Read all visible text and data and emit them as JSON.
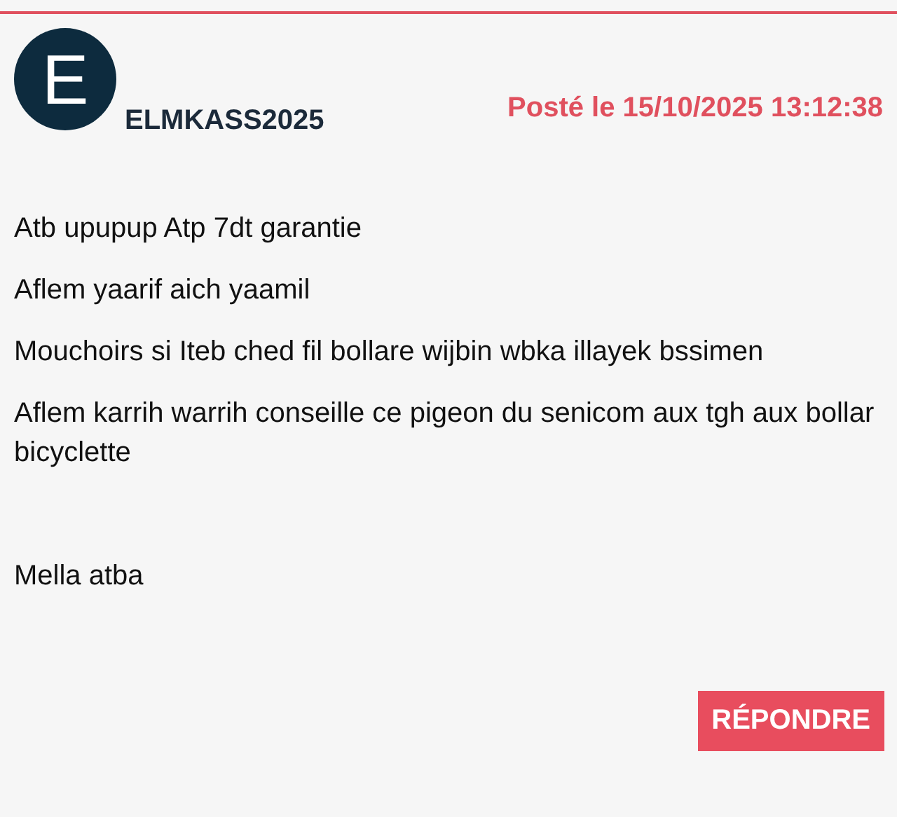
{
  "post": {
    "avatar_letter": "E",
    "username": "ELMKASS2025",
    "posted": "Posté le 15/10/2025 13:12:38",
    "paragraphs": [
      "Atb upupup Atp 7dt garantie",
      "Aflem yaarif aich yaamil",
      "Mouchoirs si Iteb ched fil bollare wijbin wbka illayek bssimen",
      "Aflem karrih warrih conseille ce pigeon du senicom aux tgh aux bollar bicyclette",
      "Mella atba"
    ]
  },
  "buttons": [
    "RÉPONDRE"
  ]
}
